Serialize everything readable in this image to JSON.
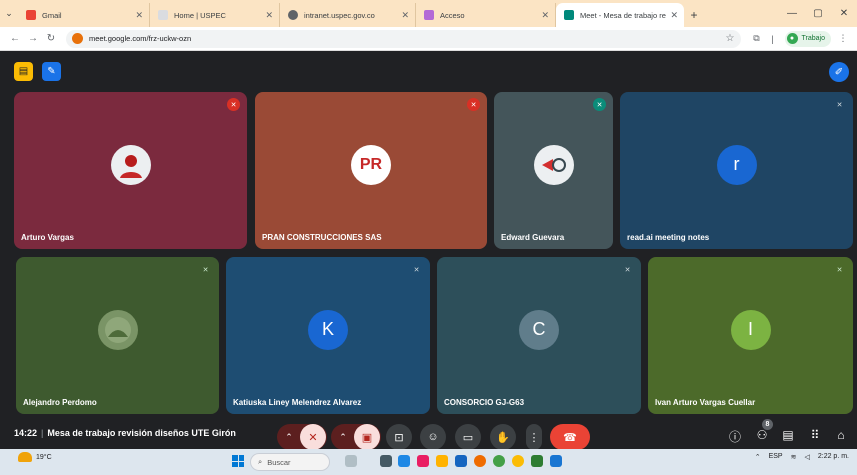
{
  "browser": {
    "tabs": [
      {
        "title": "Gmail",
        "favicon_color": "#ea4335"
      },
      {
        "title": "Home | USPEC",
        "favicon_color": "#9aa0a6"
      },
      {
        "title": "intranet.uspec.gov.co",
        "favicon_color": "#5f6368"
      },
      {
        "title": "Acceso",
        "favicon_color": "#9c27b0"
      },
      {
        "title": "Meet - Mesa de trabajo revisió",
        "favicon_color": "#00897b"
      }
    ],
    "new_tab": "+",
    "url": "meet.google.com/frz-uckw-ozn",
    "profile_label": "Trabajo",
    "window_controls": [
      "—",
      "▢",
      "✕"
    ]
  },
  "meet": {
    "participants": [
      {
        "name": "Arturo Vargas",
        "bg": "#7b2a3e",
        "avatar_color": "#b71c1c",
        "mic": "red",
        "avatar_text": ""
      },
      {
        "name": "PRAN CONSTRUCCIONES SAS",
        "bg": "#9a4a36",
        "avatar_color": "#ffffff",
        "mic": "red",
        "avatar_text": "PR"
      },
      {
        "name": "Edward Guevara",
        "bg": "#44555a",
        "avatar_color": "#eceff1",
        "mic": "teal",
        "avatar_text": ""
      },
      {
        "name": "read.ai meeting notes",
        "bg": "#1f4564",
        "avatar_color": "#1967d2",
        "mic": "plain",
        "avatar_text": "r"
      },
      {
        "name": "Alejandro Perdomo",
        "bg": "#3e5a2f",
        "avatar_color": "#6e8b5e",
        "mic": "green",
        "avatar_text": ""
      },
      {
        "name": "Katiuska Liney Melendrez Alvarez",
        "bg": "#1e4d72",
        "avatar_color": "#1967d2",
        "mic": "plain",
        "avatar_text": "K"
      },
      {
        "name": "CONSORCIO GJ-G63",
        "bg": "#2d4f5a",
        "avatar_color": "#607d8b",
        "mic": "plain",
        "avatar_text": "C"
      },
      {
        "name": "Ivan Arturo Vargas Cuellar",
        "bg": "#4c6a2a",
        "avatar_color": "#7cb342",
        "mic": "green",
        "avatar_text": "I"
      }
    ],
    "time": "14:22",
    "meeting_title": "Mesa de trabajo revisión diseños UTE Girón",
    "people_count": "8"
  },
  "taskbar": {
    "temperature": "19°C",
    "search_placeholder": "Buscar",
    "language": "ESP",
    "clock_time": "2:22 p. m."
  }
}
